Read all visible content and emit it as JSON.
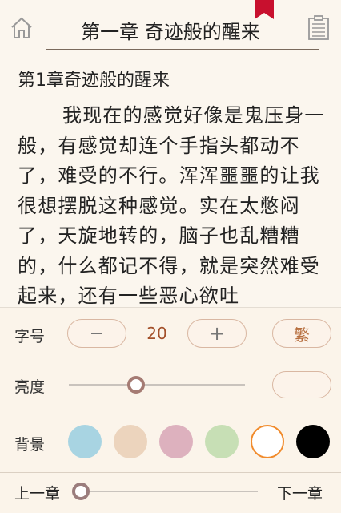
{
  "header": {
    "title": "第一章 奇迹般的醒来",
    "icons": {
      "home": "home-icon",
      "menu": "clipboard-list-icon",
      "bookmark": "bookmark-icon"
    },
    "bookmark_color": "#c8102e"
  },
  "reader": {
    "chapter_heading": "第1章奇迹般的醒来",
    "paragraph": "我现在的感觉好像是鬼压身一般，有感觉却连个手指头都动不了，难受的不行。浑浑噩噩的让我很想摆脱这种感觉。实在太憋闷了，天旋地转的，脑子也乱糟糟的，什么都记不得，就是突然难受起来，还有一些恶心欲吐"
  },
  "settings": {
    "font_size": {
      "label": "字号",
      "minus": "−",
      "value": "20",
      "plus": "+",
      "traditional": "繁"
    },
    "brightness": {
      "label": "亮度",
      "level": 0.38,
      "night_icon": "moon-icon"
    },
    "background": {
      "label": "背景",
      "swatches": [
        "#a8d4e2",
        "#ecd4bd",
        "#ddb1be",
        "#c7dfb5",
        "#ffffff",
        "#000000"
      ],
      "selected_index": 4,
      "selected_ring": "#f18b2c"
    },
    "chapter_nav": {
      "prev": "上一章",
      "next": "下一章",
      "progress": 0.0
    }
  }
}
